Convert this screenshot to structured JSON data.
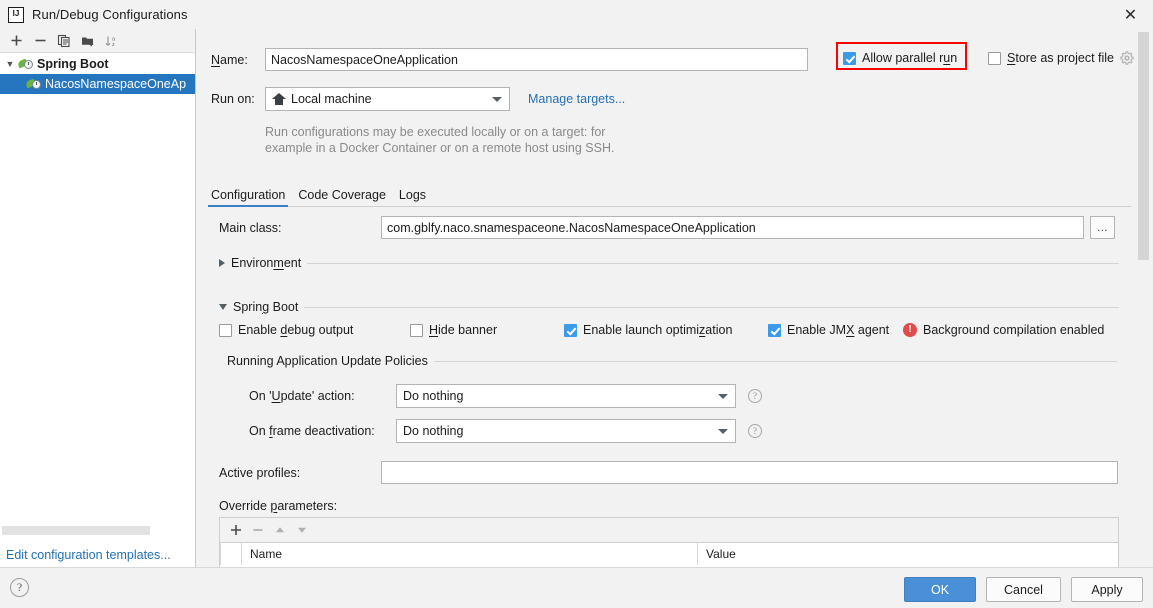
{
  "window": {
    "title": "Run/Debug Configurations",
    "app_icon": "intellij-idea-icon",
    "close_icon": "close-icon"
  },
  "sidebar": {
    "toolbar": [
      {
        "name": "add-configuration-button",
        "icon": "plus-icon",
        "label": "+"
      },
      {
        "name": "remove-configuration-button",
        "icon": "minus-icon",
        "label": "−"
      },
      {
        "name": "copy-configuration-button",
        "icon": "copy-icon",
        "label": ""
      },
      {
        "name": "save-configuration-button",
        "icon": "folder-add-icon",
        "label": ""
      },
      {
        "name": "sort-configurations-button",
        "icon": "sort-alpha-icon",
        "label": ""
      }
    ],
    "tree": [
      {
        "label": "Spring Boot",
        "icon": "spring-boot-icon",
        "group": true,
        "expanded": true,
        "selected": false
      },
      {
        "label": "NacosNamespaceOneAp",
        "icon": "spring-boot-icon",
        "group": false,
        "expanded": false,
        "selected": true
      }
    ],
    "edit_templates_link": "Edit configuration templates..."
  },
  "form": {
    "name_label": "Name:",
    "name_value": "NacosNamespaceOneApplication",
    "allow_parallel_run": {
      "label": "Allow parallel run",
      "checked": true,
      "highlighted": true
    },
    "store_as_project_file": {
      "label": "Store as project file",
      "checked": false,
      "gear_icon": "gear-icon"
    },
    "run_on_label": "Run on:",
    "run_on_value": "Local machine",
    "run_on_icon": "home-icon",
    "manage_targets_link": "Manage targets...",
    "hint_line1": "Run configurations may be executed locally or on a target: for",
    "hint_line2": "example in a Docker Container or on a remote host using SSH."
  },
  "tabs": [
    {
      "label": "Configuration",
      "active": true
    },
    {
      "label": "Code Coverage",
      "active": false
    },
    {
      "label": "Logs",
      "active": false
    }
  ],
  "configuration": {
    "main_class_label": "Main class:",
    "main_class_value": "com.gblfy.naco.snamespaceone.NacosNamespaceOneApplication",
    "browse_button_label": "...",
    "environment_section": {
      "label": "Environment",
      "expanded": false
    },
    "spring_boot_section": {
      "label": "Spring Boot",
      "expanded": true
    },
    "checkboxes": [
      {
        "label": "Enable debug output",
        "checked": false
      },
      {
        "label": "Hide banner",
        "checked": false
      },
      {
        "label": "Enable launch optimization",
        "checked": true
      },
      {
        "label": "Enable JMX agent",
        "checked": true
      }
    ],
    "background_compilation": {
      "label": "Background compilation enabled",
      "icon": "error-icon"
    },
    "update_policies_label": "Running Application Update Policies",
    "on_update_action_label": "On 'Update' action:",
    "on_update_action_value": "Do nothing",
    "on_frame_deactivation_label": "On frame deactivation:",
    "on_frame_deactivation_value": "Do nothing",
    "help_icon": "question-mark-icon",
    "active_profiles_label": "Active profiles:",
    "active_profiles_value": "",
    "override_parameters_label": "Override parameters:",
    "override_toolbar": [
      {
        "name": "add-parameter-button",
        "icon": "plus-icon",
        "label": "+"
      },
      {
        "name": "remove-parameter-button",
        "icon": "minus-icon",
        "label": "−"
      },
      {
        "name": "move-parameter-up-button",
        "icon": "triangle-up-icon",
        "label": ""
      },
      {
        "name": "move-parameter-down-button",
        "icon": "triangle-down-icon",
        "label": ""
      }
    ],
    "override_table": {
      "columns": [
        "Name",
        "Value"
      ],
      "rows": []
    }
  },
  "footer": {
    "help_icon": "question-mark-icon",
    "ok_label": "OK",
    "cancel_label": "Cancel",
    "apply_label": "Apply"
  },
  "colors": {
    "accent_blue": "#4a90d9",
    "selection_blue": "#2675bf",
    "link_blue": "#2470b3",
    "checkbox_blue": "#3d9ae8",
    "highlight_red": "#ff0000",
    "error_red": "#e04b4b",
    "spring_green": "#6db33f",
    "dialog_bg": "#f2f2f2"
  }
}
